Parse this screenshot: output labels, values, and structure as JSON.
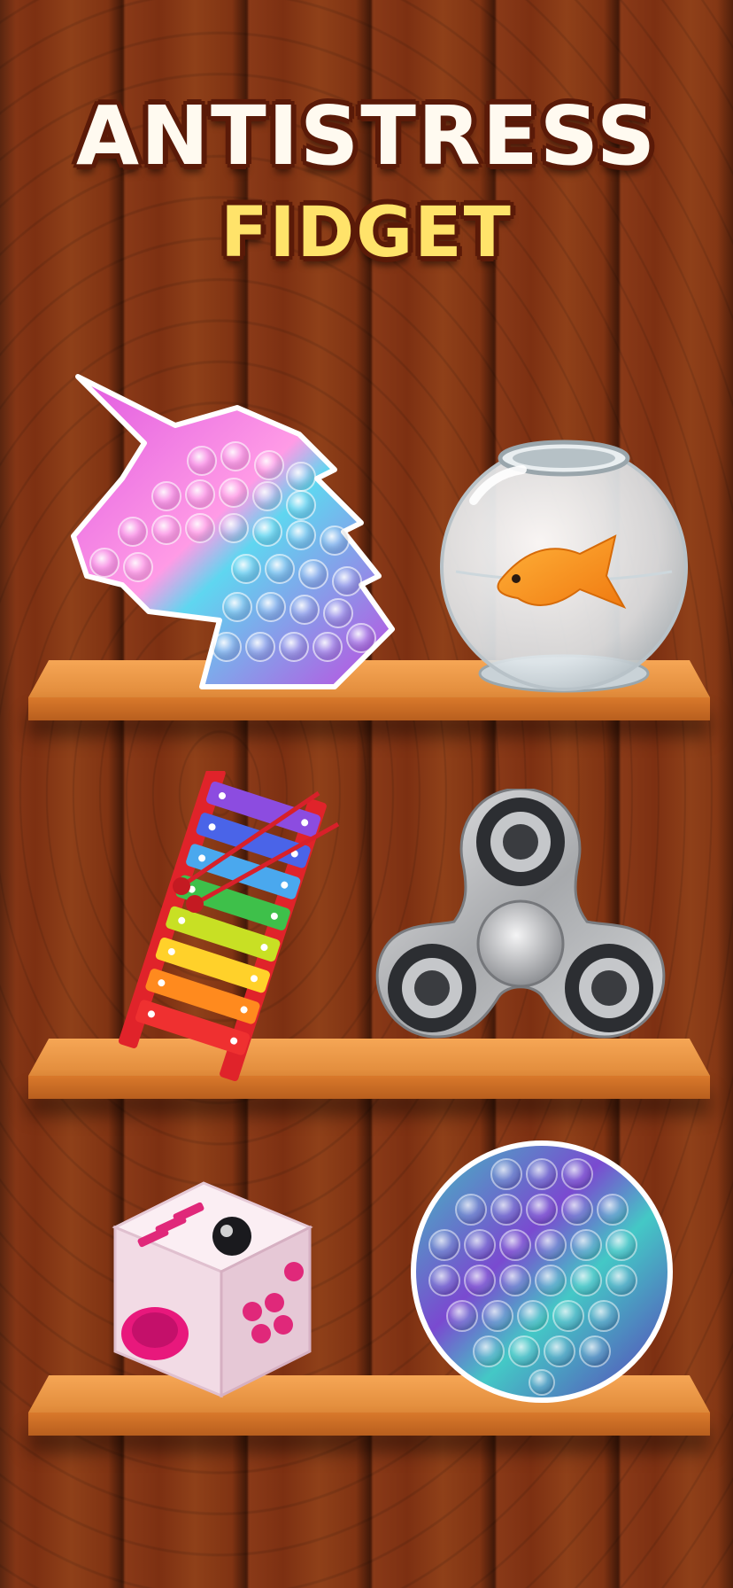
{
  "title": {
    "line1": "ANTISTRESS",
    "line2": "FIDGET"
  },
  "colors": {
    "wood_dark": "#6a2410",
    "wood_mid": "#8a3a18",
    "shelf_top": "#f6a655",
    "shelf_front": "#d9792b",
    "title_white": "#fffaf0",
    "title_yellow": "#ffe36a",
    "title_outline": "#5a1a08"
  },
  "shelves": [
    {
      "items": [
        {
          "icon": "unicorn-pop-it-icon"
        },
        {
          "icon": "fishbowl-icon"
        }
      ]
    },
    {
      "items": [
        {
          "icon": "xylophone-icon"
        },
        {
          "icon": "fidget-spinner-icon"
        }
      ]
    },
    {
      "items": [
        {
          "icon": "fidget-cube-icon"
        },
        {
          "icon": "round-pop-it-icon"
        }
      ]
    }
  ]
}
